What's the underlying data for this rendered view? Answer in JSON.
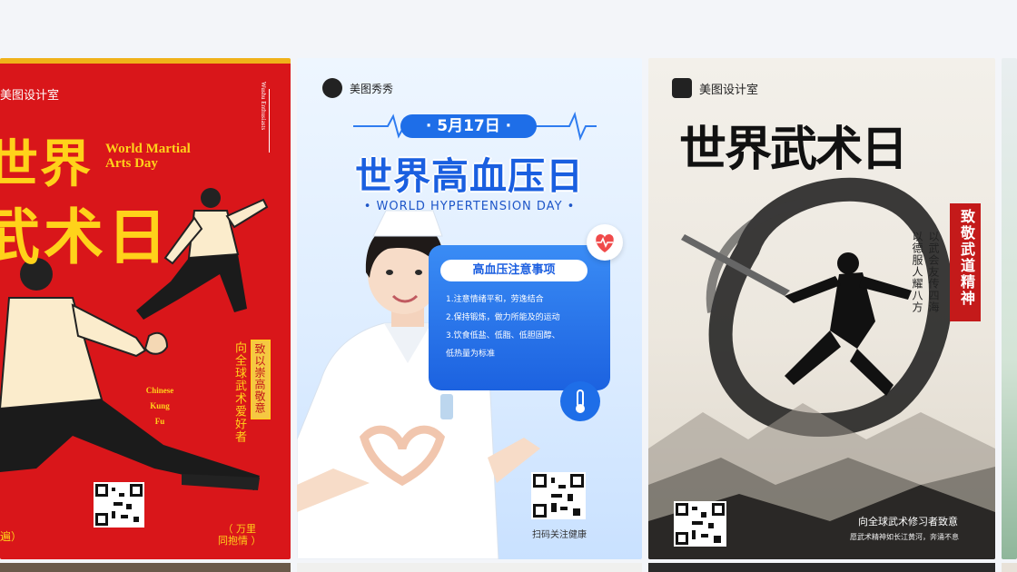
{
  "cards": [
    {
      "brand": "美图设计室",
      "vertical_en": "Wushu Enthusiasts",
      "title_line1": "世界",
      "title_line2": "武术日",
      "en_line1": "World Martial",
      "en_line2": "Arts Day",
      "vertical_cn1": "向全球武术爱好者",
      "vertical_cn2": "致以崇高敬意",
      "chinese_kung_fu": [
        "Chinese",
        "Kung",
        "Fu"
      ],
      "footer_left": "遍）",
      "footer_right": "（ 万里\n同抱情 ）"
    },
    {
      "brand": "美图秀秀",
      "date": "· 5月17日 ·",
      "title": "世界高血压日",
      "subtitle": "• WORLD HYPERTENSION DAY •",
      "panel_title": "高血压注意事项",
      "panel_items": [
        "1.注意情绪平和，劳逸结合",
        "2.保持锻炼，做力所能及的运动",
        "3.饮食低盐、低脂、低胆固醇、",
        "低热量为标准"
      ],
      "scan_text": "扫码关注健康"
    },
    {
      "brand": "美图设计室",
      "title": "世界武术日",
      "red_vertical": "致敬武道精神",
      "vertical_1": "以武会友传四海",
      "vertical_2": "以德服人耀八方",
      "footer_1": "向全球武术修习者致意",
      "footer_2": "愿武术精神如长江黄河，奔涌不息"
    }
  ],
  "icons": [
    "heart-monitor-icon",
    "thermometer-icon",
    "qr-code-icon"
  ],
  "colors": {
    "c1_bg": "#d9161a",
    "c1_gold": "#ffd21a",
    "c2_blue": "#1e6ee8",
    "c3_red": "#c41a1a"
  }
}
